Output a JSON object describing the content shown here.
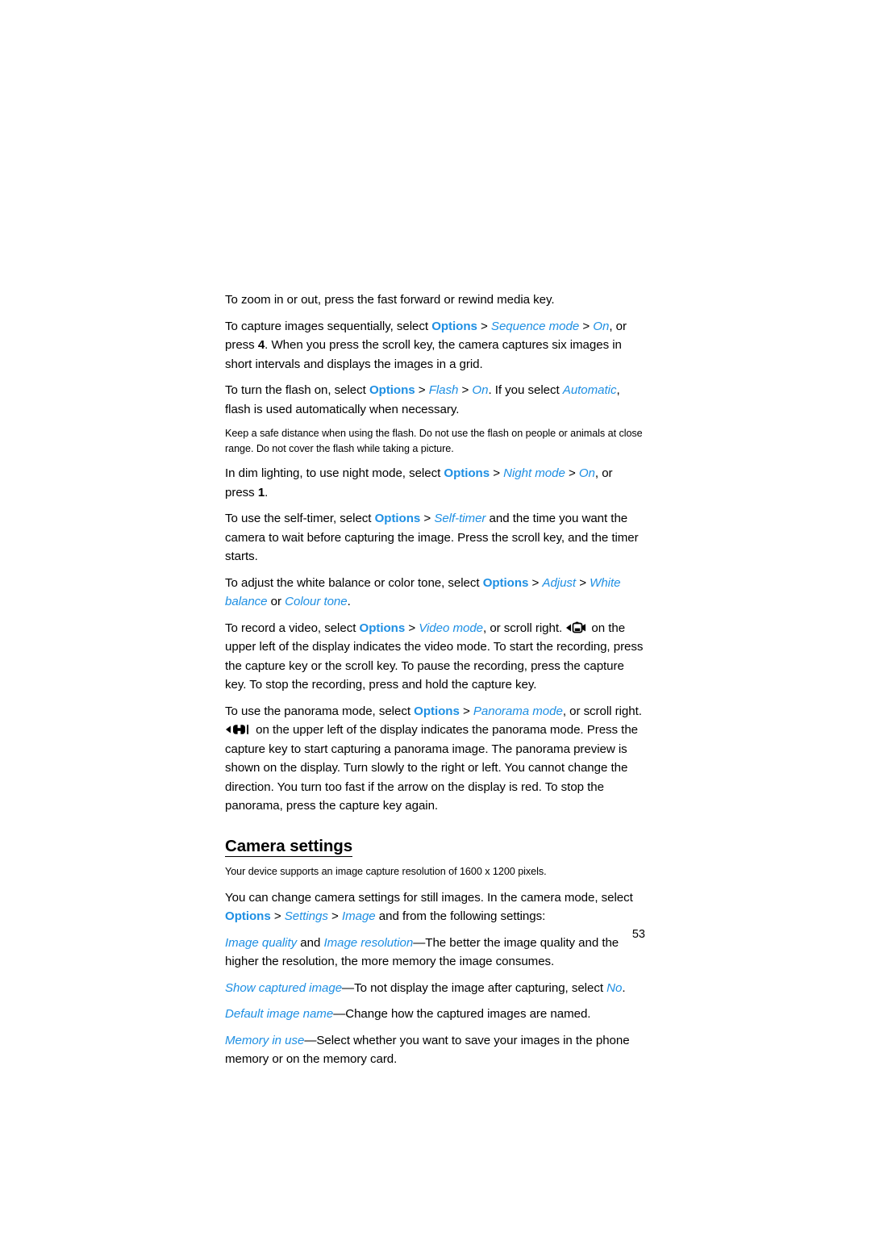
{
  "document": {
    "page_number": "53",
    "accent_color": "#1e8fe3",
    "text_color": "#000000",
    "background": "#ffffff"
  },
  "body": {
    "p1": {
      "text": "To zoom in or out, press the fast forward or rewind media key."
    },
    "p2": {
      "t1": "To capture images sequentially, select ",
      "k1": "Options",
      "sep1": " > ",
      "k2": "Sequence mode",
      "sep2": " > ",
      "k3": "On",
      "t2": ", or press ",
      "key": "4",
      "t3": ". When you press the scroll key, the camera captures six images in short intervals and displays the images in a grid."
    },
    "p3": {
      "t1": "To turn the flash on, select ",
      "k1": "Options",
      "sep1": " > ",
      "k2": "Flash",
      "sep2": " > ",
      "k3": "On",
      "t2": ". If you select ",
      "k4": "Automatic",
      "t3": ", flash is used automatically when necessary."
    },
    "note1": {
      "text": "Keep a safe distance when using the flash. Do not use the flash on people or animals at close range. Do not cover the flash while taking a picture."
    },
    "p4": {
      "t1": "In dim lighting, to use night mode, select ",
      "k1": "Options",
      "sep1": " > ",
      "k2": "Night mode",
      "sep2": " > ",
      "k3": "On",
      "t2": ", or press ",
      "key": "1",
      "t3": "."
    },
    "p5": {
      "t1": "To use the self-timer, select ",
      "k1": "Options",
      "sep1": " > ",
      "k2": "Self-timer",
      "t2": " and the time you want the camera to wait before capturing the image. Press the scroll key, and the timer starts."
    },
    "p6": {
      "t1": "To adjust the white balance or color tone, select ",
      "k1": "Options",
      "sep1": " > ",
      "k2": "Adjust",
      "sep2": " > ",
      "k3": "White balance",
      "t2": " or ",
      "k4": "Colour tone",
      "t3": "."
    },
    "p7": {
      "t1": "To record a video, select ",
      "k1": "Options",
      "sep1": " > ",
      "k2": "Video mode",
      "t2": ", or scroll right. ",
      "icon": "video-camera-icon",
      "t3": " on the upper left of the display indicates the video mode. To start the recording, press the capture key or the scroll key. To pause the recording, press the capture key. To stop the recording, press and hold the capture key."
    },
    "p8": {
      "t1": "To use the panorama mode, select ",
      "k1": "Options",
      "sep1": " > ",
      "k2": "Panorama mode",
      "t2": ", or scroll right. ",
      "icon": "panorama-icon",
      "t3": " on the upper left of the display indicates the panorama mode. Press the capture key to start capturing a panorama image. The panorama preview is shown on the display. Turn slowly to the right or left. You cannot change the direction. You turn too fast if the arrow on the display is red. To stop the panorama, press the capture key again."
    }
  },
  "section": {
    "heading": "Camera settings",
    "caption": "Your device supports an image capture resolution of 1600 x 1200 pixels.",
    "p9": {
      "t1": "You can change camera settings for still images. In the camera mode, select ",
      "k1": "Options",
      "sep1": " > ",
      "k2": "Settings",
      "sep2": " > ",
      "k3": "Image",
      "t2": " and from the following settings:"
    },
    "s1": {
      "k1": "Image quality",
      "t1": " and ",
      "k2": "Image resolution",
      "t2": "—The better the image quality and the higher the resolution, the more memory the image consumes."
    },
    "s2": {
      "k1": "Show captured image",
      "t1": "—To not display the image after capturing, select ",
      "k2": "No",
      "t2": "."
    },
    "s3": {
      "k1": "Default image name",
      "t1": "—Change how the captured images are named."
    },
    "s4": {
      "k1": "Memory in use",
      "t1": "—Select whether you want to save your images in the phone memory or on the memory card."
    }
  }
}
